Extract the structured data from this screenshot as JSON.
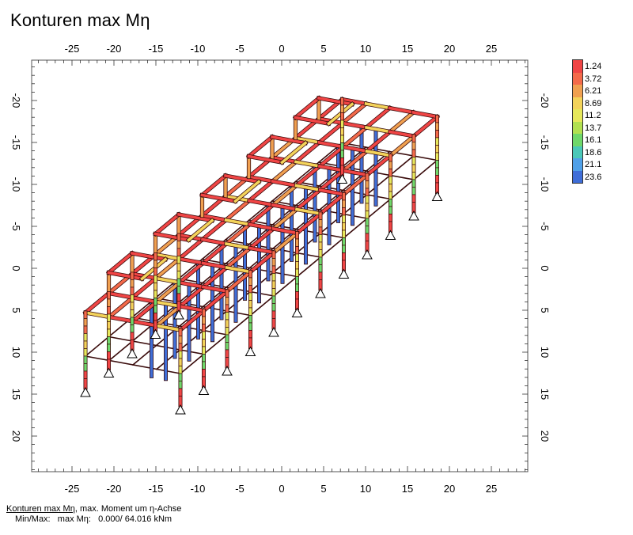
{
  "title": "Konturen max Mη",
  "axes": {
    "x_ticks": [
      "-25",
      "-20",
      "-15",
      "-10",
      "-5",
      "0",
      "5",
      "10",
      "15",
      "20",
      "25"
    ],
    "y_ticks": [
      "-20",
      "-15",
      "-10",
      "-5",
      "0",
      "5",
      "10",
      "15",
      "20"
    ]
  },
  "legend": {
    "values": [
      "1.24",
      "3.72",
      "6.21",
      "8.69",
      "11.2",
      "13.7",
      "16.1",
      "18.6",
      "21.1",
      "23.6"
    ],
    "colors": [
      "#f04545",
      "#f46a4a",
      "#f0a050",
      "#f3d35a",
      "#e6e85a",
      "#b2e150",
      "#6fd86a",
      "#4ac8b8",
      "#4fa0e8",
      "#3f6ed8"
    ]
  },
  "footer": {
    "line1_underlined": "Konturen max Mη",
    "line1_rest": ", max. Moment um η-Achse",
    "line2": "Min/Max:   max Mη:   0.000/ 64.016 kNm"
  }
}
